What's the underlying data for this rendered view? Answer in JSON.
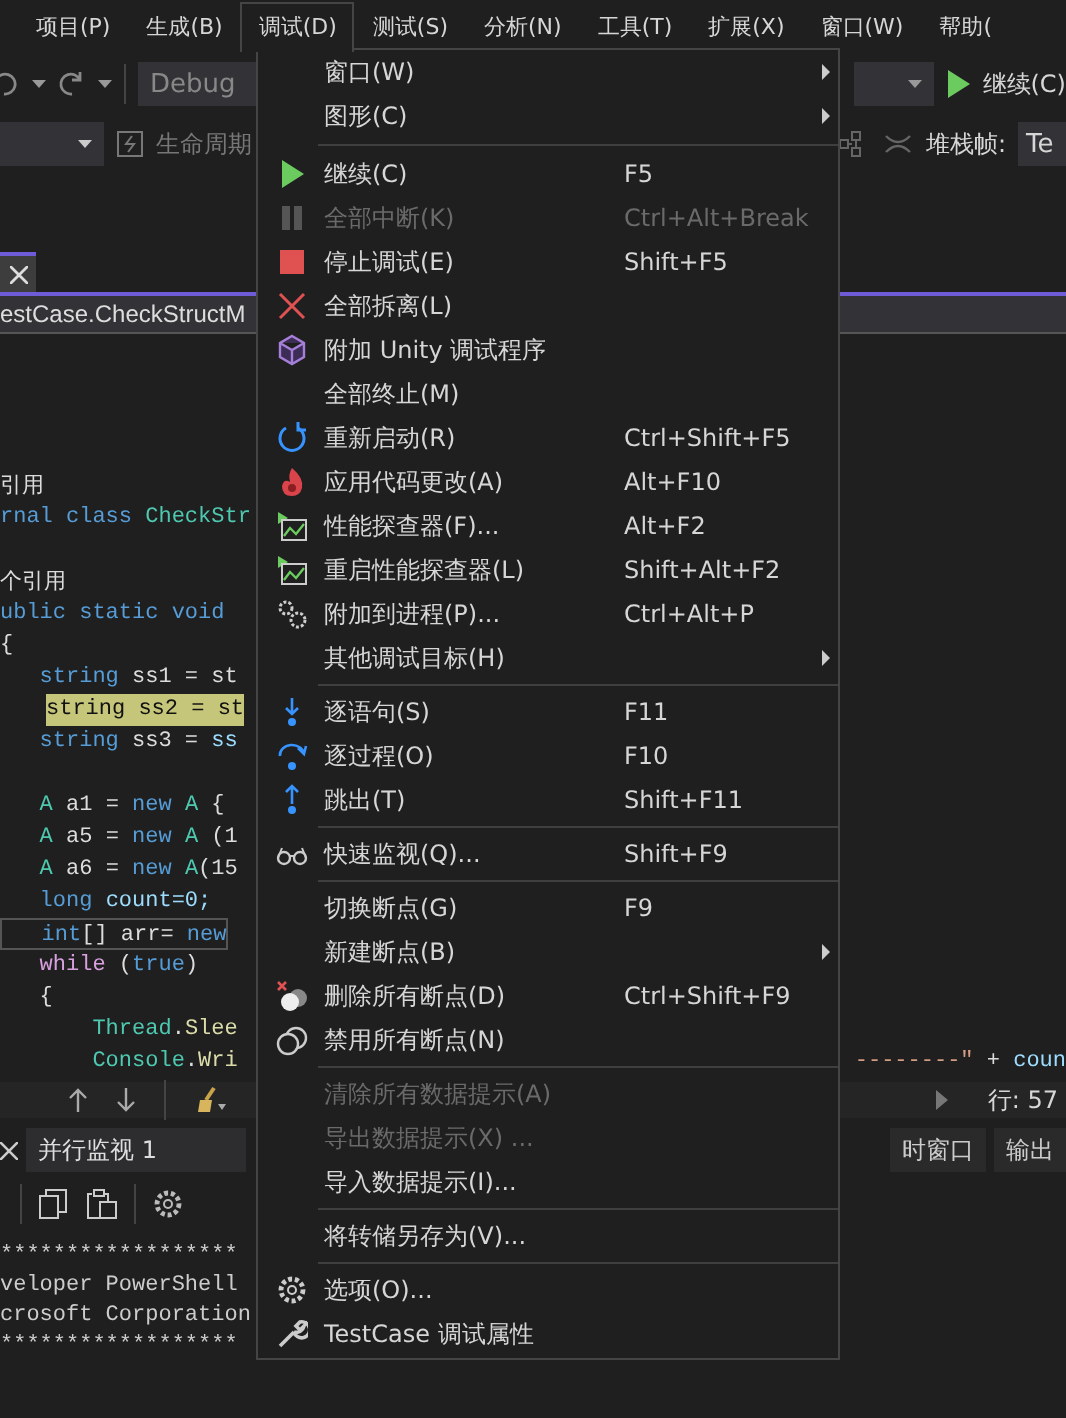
{
  "menu_bar": {
    "items": [
      {
        "label": "项目(P)",
        "selected": false
      },
      {
        "label": "生成(B)",
        "selected": false
      },
      {
        "label": "调试(D)",
        "selected": true
      },
      {
        "label": "测试(S)",
        "selected": false
      },
      {
        "label": "分析(N)",
        "selected": false
      },
      {
        "label": "工具(T)",
        "selected": false
      },
      {
        "label": "扩展(X)",
        "selected": false
      },
      {
        "label": "窗口(W)",
        "selected": false
      },
      {
        "label": "帮助(",
        "selected": false
      }
    ]
  },
  "toolbar": {
    "configuration": "Debug",
    "continue_label": "继续(C)",
    "lifecycle_label": "生命周期",
    "stack_frame_label": "堆栈帧:",
    "stack_frame_value": "Te"
  },
  "editor": {
    "breadcrumb": "estCase.CheckStructM",
    "lines": [
      {
        "kind": "codelens",
        "tokens": [
          {
            "text": "引用",
            "kind": "plain"
          }
        ],
        "highlighted": false,
        "current_line": false
      },
      {
        "kind": "code",
        "tokens": [
          {
            "text": "rnal class ",
            "kind": "keyword"
          },
          {
            "text": "CheckStr",
            "kind": "type"
          }
        ],
        "highlighted": false,
        "current_line": false
      },
      {
        "kind": "blank"
      },
      {
        "kind": "codelens",
        "tokens": [
          {
            "text": "个引用",
            "kind": "plain"
          }
        ],
        "highlighted": false,
        "current_line": false
      },
      {
        "kind": "code",
        "tokens": [
          {
            "text": "ublic static void",
            "kind": "keyword"
          }
        ],
        "highlighted": false,
        "current_line": false
      },
      {
        "kind": "code",
        "tokens": [
          {
            "text": "{",
            "kind": "plain"
          }
        ],
        "highlighted": false,
        "current_line": false
      },
      {
        "kind": "code",
        "tokens": [
          {
            "text": "   string ",
            "kind": "keyword"
          },
          {
            "text": "ss1 = st",
            "kind": "plain"
          }
        ],
        "highlighted": false,
        "current_line": false
      },
      {
        "kind": "code",
        "tokens": [
          {
            "text": "   string ss2 = st",
            "kind": "plain"
          }
        ],
        "highlighted": true,
        "current_line": false
      },
      {
        "kind": "code",
        "tokens": [
          {
            "text": "   string ",
            "kind": "keyword"
          },
          {
            "text": "ss3 = ",
            "kind": "plain"
          },
          {
            "text": "ss",
            "kind": "variable"
          }
        ],
        "highlighted": false,
        "current_line": false
      },
      {
        "kind": "blank"
      },
      {
        "kind": "code",
        "tokens": [
          {
            "text": "   A ",
            "kind": "type"
          },
          {
            "text": "a1 = ",
            "kind": "plain"
          },
          {
            "text": "new ",
            "kind": "keyword"
          },
          {
            "text": "A",
            "kind": "type"
          },
          {
            "text": " {",
            "kind": "plain"
          }
        ],
        "highlighted": false,
        "current_line": false
      },
      {
        "kind": "code",
        "tokens": [
          {
            "text": "   A ",
            "kind": "type"
          },
          {
            "text": "a5 = ",
            "kind": "plain"
          },
          {
            "text": "new ",
            "kind": "keyword"
          },
          {
            "text": "A",
            "kind": "type"
          },
          {
            "text": " (1",
            "kind": "plain"
          }
        ],
        "highlighted": false,
        "current_line": false
      },
      {
        "kind": "code",
        "tokens": [
          {
            "text": "   A ",
            "kind": "type"
          },
          {
            "text": "a6 = ",
            "kind": "plain"
          },
          {
            "text": "new ",
            "kind": "keyword"
          },
          {
            "text": "A",
            "kind": "type"
          },
          {
            "text": "(15",
            "kind": "plain"
          }
        ],
        "highlighted": false,
        "current_line": false
      },
      {
        "kind": "code",
        "tokens": [
          {
            "text": "   long ",
            "kind": "keyword"
          },
          {
            "text": "count=0;",
            "kind": "variable"
          }
        ],
        "highlighted": false,
        "current_line": false
      },
      {
        "kind": "code",
        "tokens": [
          {
            "text": "   int",
            "kind": "keyword"
          },
          {
            "text": "[] arr= ",
            "kind": "plain"
          },
          {
            "text": "new",
            "kind": "keyword"
          }
        ],
        "highlighted": false,
        "current_line": true
      },
      {
        "kind": "code",
        "tokens": [
          {
            "text": "   while ",
            "kind": "control"
          },
          {
            "text": "(",
            "kind": "plain"
          },
          {
            "text": "true",
            "kind": "keyword"
          },
          {
            "text": ")",
            "kind": "plain"
          }
        ],
        "highlighted": false,
        "current_line": false
      },
      {
        "kind": "code",
        "tokens": [
          {
            "text": "   {",
            "kind": "plain"
          }
        ],
        "highlighted": false,
        "current_line": false
      },
      {
        "kind": "code",
        "tokens": [
          {
            "text": "       Thread",
            "kind": "type"
          },
          {
            "text": ".",
            "kind": "plain"
          },
          {
            "text": "Slee",
            "kind": "method"
          }
        ],
        "highlighted": false,
        "current_line": false
      },
      {
        "kind": "code",
        "tokens": [
          {
            "text": "       Console",
            "kind": "type"
          },
          {
            "text": ".",
            "kind": "plain"
          },
          {
            "text": "Wri",
            "kind": "method"
          }
        ],
        "tail": [
          {
            "text": "--------\" ",
            "kind": "string"
          },
          {
            "text": "+ ",
            "kind": "plain"
          },
          {
            "text": "coun",
            "kind": "variable"
          }
        ],
        "highlighted": false,
        "current_line": false
      }
    ],
    "line_status": "行: 57"
  },
  "bottom_panel": {
    "tabs": [
      {
        "label": "并行监视 1",
        "selected": true
      },
      {
        "label": "时窗口",
        "selected": false
      },
      {
        "label": "输出",
        "selected": false
      }
    ]
  },
  "terminal": {
    "lines": [
      "******************",
      "veloper PowerShell",
      "crosoft Corporation",
      "******************"
    ]
  },
  "menu": {
    "groups": [
      [
        {
          "label": "窗口(W)",
          "disabled": false,
          "submenu": true
        },
        {
          "label": "图形(C)",
          "disabled": false,
          "submenu": true
        }
      ],
      [
        {
          "label": "继续(C)",
          "shortcut": "F5",
          "disabled": false,
          "submenu": false
        },
        {
          "label": "全部中断(K)",
          "shortcut": "Ctrl+Alt+Break",
          "disabled": true,
          "submenu": false
        },
        {
          "label": "停止调试(E)",
          "shortcut": "Shift+F5",
          "disabled": false,
          "submenu": false
        },
        {
          "label": "全部拆离(L)",
          "disabled": false,
          "submenu": false
        },
        {
          "label": "附加 Unity 调试程序",
          "disabled": false,
          "submenu": false
        },
        {
          "label": "全部终止(M)",
          "disabled": false,
          "submenu": false
        },
        {
          "label": "重新启动(R)",
          "shortcut": "Ctrl+Shift+F5",
          "disabled": false,
          "submenu": false
        },
        {
          "label": "应用代码更改(A)",
          "shortcut": "Alt+F10",
          "disabled": false,
          "submenu": false
        },
        {
          "label": "性能探查器(F)...",
          "shortcut": "Alt+F2",
          "disabled": false,
          "submenu": false
        },
        {
          "label": "重启性能探查器(L)",
          "shortcut": "Shift+Alt+F2",
          "disabled": false,
          "submenu": false
        },
        {
          "label": "附加到进程(P)...",
          "shortcut": "Ctrl+Alt+P",
          "disabled": false,
          "submenu": false
        },
        {
          "label": "其他调试目标(H)",
          "disabled": false,
          "submenu": true
        }
      ],
      [
        {
          "label": "逐语句(S)",
          "shortcut": "F11",
          "disabled": false,
          "submenu": false
        },
        {
          "label": "逐过程(O)",
          "shortcut": "F10",
          "disabled": false,
          "submenu": false
        },
        {
          "label": "跳出(T)",
          "shortcut": "Shift+F11",
          "disabled": false,
          "submenu": false
        }
      ],
      [
        {
          "label": "快速监视(Q)...",
          "shortcut": "Shift+F9",
          "disabled": false,
          "submenu": false
        }
      ],
      [
        {
          "label": "切换断点(G)",
          "shortcut": "F9",
          "disabled": false,
          "submenu": false
        },
        {
          "label": "新建断点(B)",
          "disabled": false,
          "submenu": true
        },
        {
          "label": "删除所有断点(D)",
          "shortcut": "Ctrl+Shift+F9",
          "disabled": false,
          "submenu": false
        },
        {
          "label": "禁用所有断点(N)",
          "disabled": false,
          "submenu": false
        }
      ],
      [
        {
          "label": "清除所有数据提示(A)",
          "disabled": true,
          "submenu": false
        },
        {
          "label": "导出数据提示(X) ...",
          "disabled": true,
          "submenu": false
        },
        {
          "label": "导入数据提示(I)...",
          "disabled": false,
          "submenu": false
        }
      ],
      [
        {
          "label": "将转储另存为(V)...",
          "disabled": false,
          "submenu": false
        }
      ],
      [
        {
          "label": "选项(O)...",
          "disabled": false,
          "submenu": false
        },
        {
          "label": "TestCase 调试属性",
          "disabled": false,
          "submenu": false
        }
      ]
    ]
  }
}
